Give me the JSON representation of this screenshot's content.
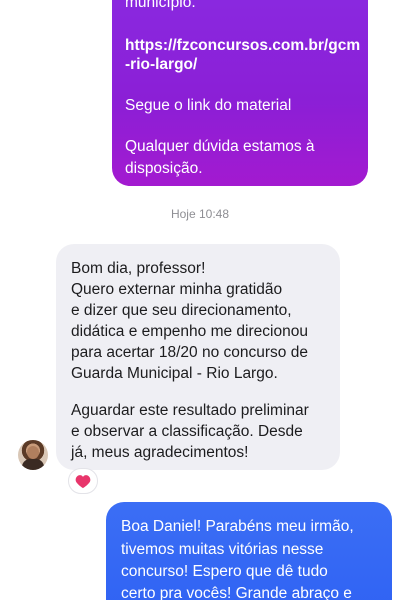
{
  "messages": {
    "outgoing_purple": {
      "lines": [
        "município.",
        "https://fzconcursos.com.br/gcm",
        "-rio-largo/",
        "Segue o link do material",
        "Qualquer dúvida estamos à",
        "disposição."
      ]
    },
    "timestamp": "Hoje 10:48",
    "incoming": {
      "lines": [
        "Bom dia, professor!",
        "Quero externar minha gratidão",
        "e dizer que seu direcionamento,",
        "didática e empenho me direcionou",
        "para acertar 18/20 no concurso de",
        "Guarda Municipal - Rio Largo.",
        "Aguardar este resultado preliminar",
        "e observar a classificação. Desde",
        "já, meus agradecimentos!"
      ],
      "reaction_icon": "heart-icon",
      "reaction_color": "#e8356b"
    },
    "outgoing_blue": {
      "lines": [
        "Boa Daniel! Parabéns meu irmão,",
        "tivemos muitas vitórias nesse",
        "concurso! Espero que dê tudo",
        "certo pra vocês! Grande abraço e"
      ]
    }
  },
  "colors": {
    "purple_bubble": "#8a2be2",
    "blue_bubble": "#2f62f3",
    "incoming_bubble": "#efeff4",
    "timestamp_text": "#8e8e93"
  }
}
